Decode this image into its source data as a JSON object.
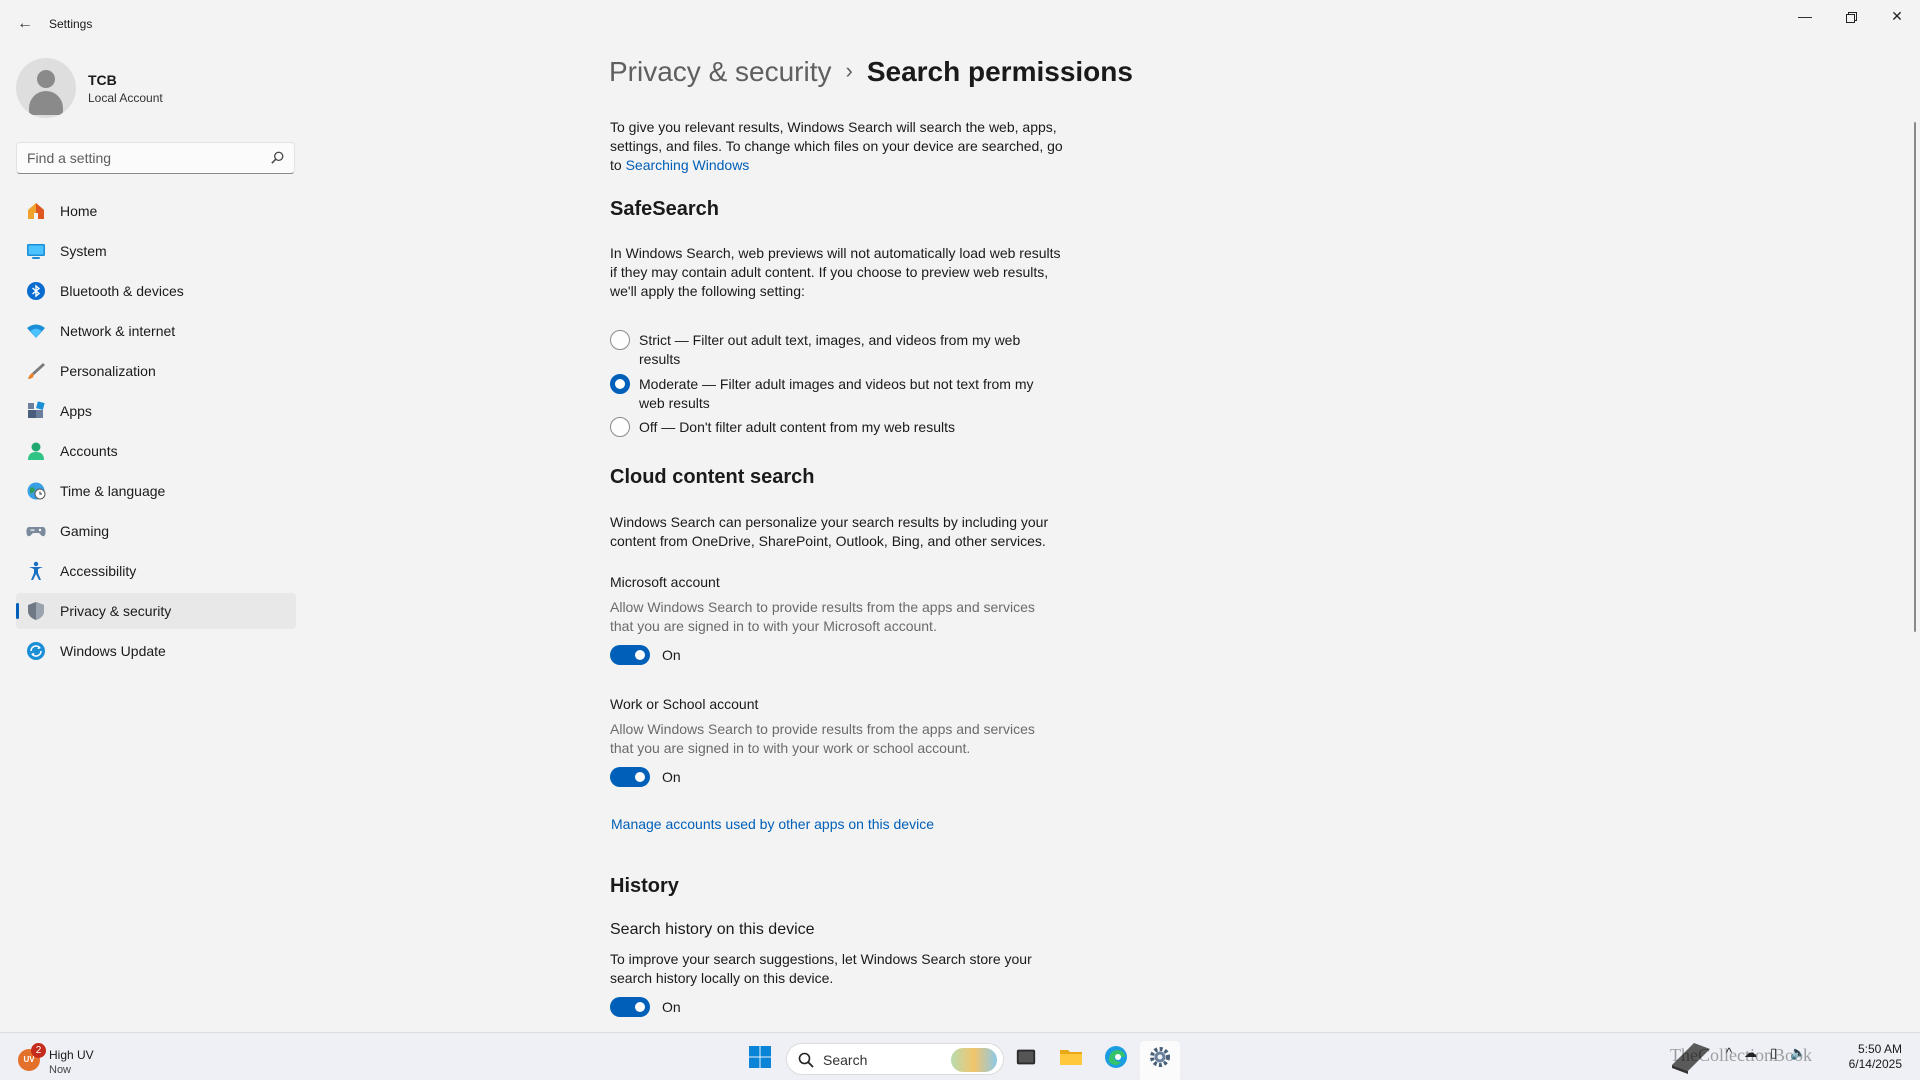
{
  "window": {
    "app_title": "Settings",
    "minimize_icon": "minimize-icon",
    "maximize_icon": "restore-icon",
    "close_icon": "close-icon"
  },
  "profile": {
    "name": "TCB",
    "account_type": "Local Account"
  },
  "search": {
    "placeholder": "Find a setting"
  },
  "nav": {
    "active": "Privacy & security",
    "items": [
      {
        "label": "Home",
        "icon": "home-icon"
      },
      {
        "label": "System",
        "icon": "system-icon"
      },
      {
        "label": "Bluetooth & devices",
        "icon": "bluetooth-icon"
      },
      {
        "label": "Network & internet",
        "icon": "wifi-icon"
      },
      {
        "label": "Personalization",
        "icon": "brush-icon"
      },
      {
        "label": "Apps",
        "icon": "apps-icon"
      },
      {
        "label": "Accounts",
        "icon": "person-icon"
      },
      {
        "label": "Time & language",
        "icon": "globe-clock-icon"
      },
      {
        "label": "Gaming",
        "icon": "gamepad-icon"
      },
      {
        "label": "Accessibility",
        "icon": "accessibility-icon"
      },
      {
        "label": "Privacy & security",
        "icon": "shield-icon"
      },
      {
        "label": "Windows Update",
        "icon": "update-icon"
      }
    ]
  },
  "breadcrumb": {
    "parent": "Privacy & security",
    "separator": "›",
    "current": "Search permissions"
  },
  "intro": {
    "text": "To give you relevant results, Windows Search will search the web, apps, settings, and files. To change which files on your device are searched, go to",
    "link": "Searching Windows"
  },
  "safesearch": {
    "heading": "SafeSearch",
    "description": "In Windows Search, web previews will not automatically load web results if they may contain adult content. If you choose to preview web results, we'll apply the following setting:",
    "selected": "Moderate",
    "options": [
      {
        "label": "Strict — Filter out adult text, images, and videos from my web results",
        "checked": false
      },
      {
        "label": "Moderate — Filter adult images and videos but not text from my web results",
        "checked": true
      },
      {
        "label": "Off — Don't filter adult content from my web results",
        "checked": false
      }
    ]
  },
  "cloud": {
    "heading": "Cloud content search",
    "description": "Windows Search can personalize your search results by including your content from OneDrive, SharePoint, Outlook, Bing, and other services.",
    "microsoft": {
      "title": "Microsoft account",
      "description": "Allow Windows Search to provide results from the apps and services that you are signed in to with your Microsoft account.",
      "state": "On"
    },
    "work": {
      "title": "Work or School account",
      "description": "Allow Windows Search to provide results from the apps and services that you are signed in to with your work or school account.",
      "state": "On"
    },
    "manage_link": "Manage accounts used by other apps on this device"
  },
  "history": {
    "heading": "History",
    "title": "Search history on this device",
    "description": "To improve your search suggestions, let Windows Search store your search history locally on this device.",
    "state": "On"
  },
  "taskbar": {
    "weather_badge": "UV",
    "weather_count": "2",
    "weather_title": "High UV",
    "weather_sub": "Now",
    "search_label": "Search",
    "watermark": "TheCollectionBook",
    "time": "5:50 AM",
    "date": "6/14/2025"
  },
  "colors": {
    "accent": "#005fb8",
    "background": "#f3f3f3",
    "taskbar": "#eef0f5"
  }
}
